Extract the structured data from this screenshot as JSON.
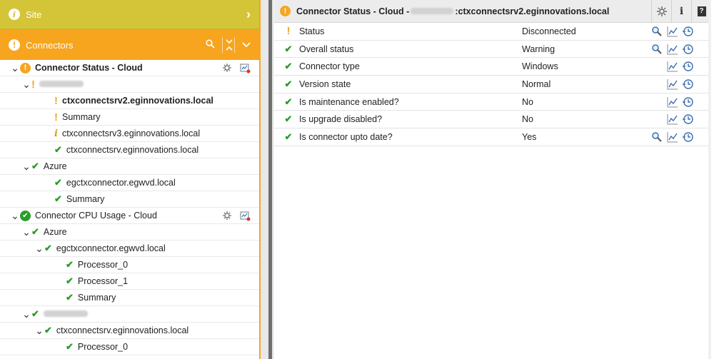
{
  "left": {
    "site": {
      "label": "Site"
    },
    "connectors": {
      "label": "Connectors"
    },
    "tree": [
      {
        "label": "Connector Status - Cloud",
        "level": 0,
        "caret": true,
        "status": "warn-circle",
        "bold": true,
        "tools": true
      },
      {
        "label": "",
        "level": 1,
        "caret": true,
        "status": "warn",
        "blur": true
      },
      {
        "label": "ctxconnectsrv2.eginnovations.local",
        "level": 3,
        "status": "warn",
        "bold": true
      },
      {
        "label": "Summary",
        "level": 3,
        "status": "warn"
      },
      {
        "label": "ctxconnectsrv3.eginnovations.local",
        "level": 3,
        "status": "info"
      },
      {
        "label": "ctxconnectsrv.eginnovations.local",
        "level": 3,
        "status": "ok"
      },
      {
        "label": "Azure",
        "level": 1,
        "caret": true,
        "status": "ok"
      },
      {
        "label": "egctxconnector.egwvd.local",
        "level": 3,
        "status": "ok"
      },
      {
        "label": "Summary",
        "level": 3,
        "status": "ok"
      },
      {
        "label": "Connector CPU Usage - Cloud",
        "level": 0,
        "caret": true,
        "status": "ok-circle",
        "tools": true
      },
      {
        "label": "Azure",
        "level": 1,
        "caret": true,
        "status": "ok"
      },
      {
        "label": "egctxconnector.egwvd.local",
        "level": 2,
        "caret": true,
        "status": "ok"
      },
      {
        "label": "Processor_0",
        "level": 4,
        "status": "ok"
      },
      {
        "label": "Processor_1",
        "level": 4,
        "status": "ok"
      },
      {
        "label": "Summary",
        "level": 4,
        "status": "ok"
      },
      {
        "label": "",
        "level": 1,
        "caret": true,
        "status": "ok",
        "blur": true
      },
      {
        "label": "ctxconnectsrv.eginnovations.local",
        "level": 2,
        "caret": true,
        "status": "ok"
      },
      {
        "label": "Processor_0",
        "level": 4,
        "status": "ok"
      }
    ]
  },
  "right": {
    "header": {
      "prefix": "Connector Status - Cloud -",
      "suffix": ":ctxconnectsrv2.eginnovations.local"
    },
    "rows": [
      {
        "name": "Status",
        "value": "Disconnected",
        "status": "warn",
        "detail": true
      },
      {
        "name": "Overall status",
        "value": "Warning",
        "status": "ok",
        "detail": true
      },
      {
        "name": "Connector type",
        "value": "Windows",
        "status": "ok",
        "detail": false
      },
      {
        "name": "Version state",
        "value": "Normal",
        "status": "ok",
        "detail": false
      },
      {
        "name": "Is maintenance enabled?",
        "value": "No",
        "status": "ok",
        "detail": false
      },
      {
        "name": "Is upgrade disabled?",
        "value": "No",
        "status": "ok",
        "detail": false
      },
      {
        "name": "Is connector upto date?",
        "value": "Yes",
        "status": "ok",
        "detail": true
      }
    ]
  },
  "colors": {
    "site_bar": "#d4c437",
    "connectors_bar": "#f7a51e",
    "ok": "#2a9d2a",
    "warn": "#f5a623"
  }
}
